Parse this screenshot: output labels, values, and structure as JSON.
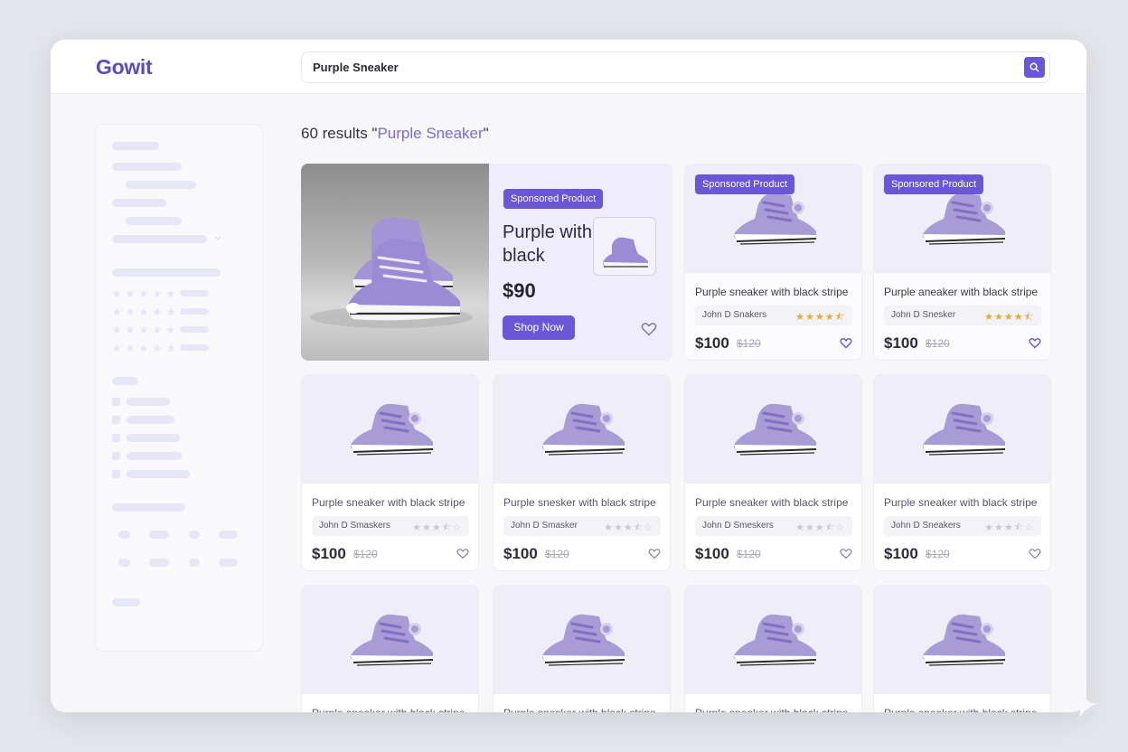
{
  "app": {
    "logo": "Gowit"
  },
  "search": {
    "value": "Purple Sneaker"
  },
  "results": {
    "count_text": "60 results \"",
    "query": "Purple Sneaker",
    "suffix": "\""
  },
  "hero": {
    "badge": "Sponsored Product",
    "title": "Purple with black",
    "price": "$90",
    "cta": "Shop Now"
  },
  "sponsored_cards": [
    {
      "badge": "Sponsored Product",
      "title": "Purple sneaker with black stripe",
      "seller": "John D Snakers",
      "rating": 4.5,
      "price": "$100",
      "old_price": "$120"
    },
    {
      "badge": "Sponsored Product",
      "title": "Purple aneaker with black stripe",
      "seller": "John D Snesker",
      "rating": 4.5,
      "price": "$100",
      "old_price": "$120"
    }
  ],
  "products": [
    {
      "title": "Purple sneaker with black stripe",
      "seller": "John D Smaskers",
      "rating": 3.5,
      "price": "$100",
      "old_price": "$120"
    },
    {
      "title": "Purple snesker with black stripe",
      "seller": "John D Smasker",
      "rating": 3.5,
      "price": "$100",
      "old_price": "$120"
    },
    {
      "title": "Purple sneaker with black stripe",
      "seller": "John D Smeskers",
      "rating": 3.5,
      "price": "$100",
      "old_price": "$120"
    },
    {
      "title": "Purple sneaker with black stripe",
      "seller": "John D Sneakers",
      "rating": 3.5,
      "price": "$100",
      "old_price": "$120"
    }
  ],
  "colors": {
    "accent": "#6a56d6",
    "logo": "#5a4bc4",
    "query": "#7d6ad8",
    "star": "#f0a52e"
  },
  "icons": [
    "search-icon",
    "heart-icon",
    "star-icon",
    "sneaker-image"
  ]
}
